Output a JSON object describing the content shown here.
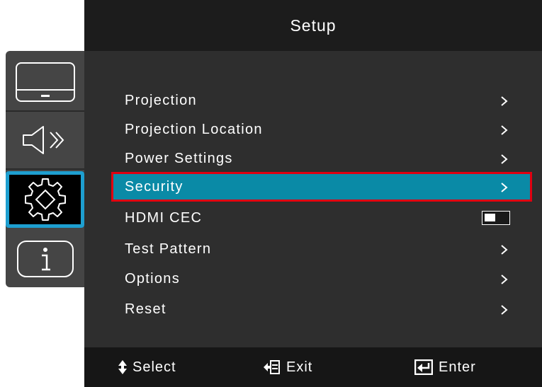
{
  "header": {
    "title": "Setup"
  },
  "sidebar": {
    "tabs": [
      {
        "name": "display",
        "icon": "monitor-icon",
        "active": false
      },
      {
        "name": "audio",
        "icon": "speaker-icon",
        "active": false
      },
      {
        "name": "setup",
        "icon": "gear-icon",
        "active": true
      },
      {
        "name": "info",
        "icon": "info-icon",
        "active": false
      }
    ]
  },
  "menu": {
    "items": [
      {
        "label": "Projection",
        "control": "chevron-right-icon"
      },
      {
        "label": "Projection Location",
        "control": "chevron-right-icon"
      },
      {
        "label": "Power Settings",
        "control": "chevron-right-icon"
      },
      {
        "label": "Security",
        "control": "chevron-right-icon",
        "selected": true
      },
      {
        "label": "HDMI CEC",
        "control": "toggle-icon",
        "toggle_state": "off"
      },
      {
        "label": "Test Pattern",
        "control": "chevron-right-icon"
      },
      {
        "label": "Options",
        "control": "chevron-right-icon"
      },
      {
        "label": "Reset",
        "control": "chevron-right-icon"
      }
    ]
  },
  "footer": {
    "select_label": "Select",
    "exit_label": "Exit",
    "enter_label": "Enter"
  },
  "colors": {
    "selected_row": "#0a8aa6",
    "highlight_outline": "#e00010",
    "active_tab_border": "#1e9fd0"
  }
}
